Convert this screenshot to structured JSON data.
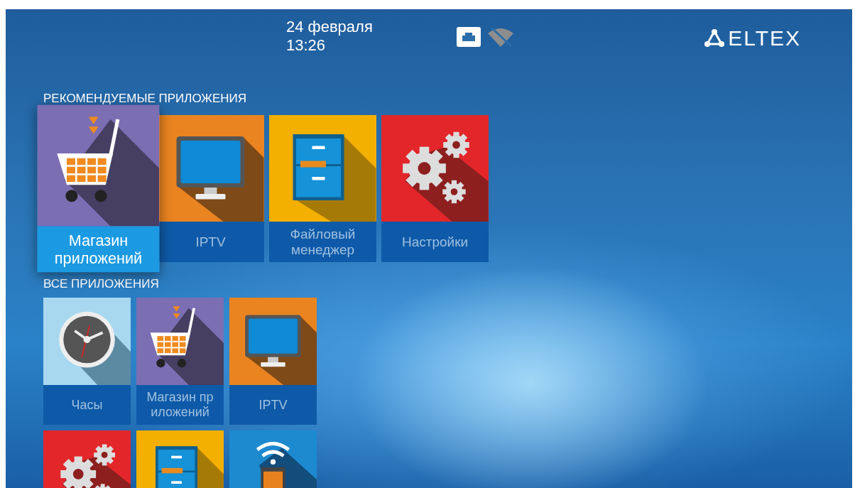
{
  "header": {
    "date": "24 февраля",
    "time": "13:26",
    "network": [
      {
        "kind": "ethernet",
        "on": true
      },
      {
        "kind": "wifi",
        "on": false
      }
    ],
    "logo": "ELTEX"
  },
  "recommended": {
    "title": "РЕКОМЕНДУЕМЫЕ ПРИЛОЖЕНИЯ",
    "apps": [
      {
        "kind": "cart",
        "label": "Магазин приложений",
        "selected": true
      },
      {
        "kind": "monitor",
        "label": "IPTV",
        "selected": false
      },
      {
        "kind": "cabinet",
        "label": "Файловый менеджер",
        "selected": false
      },
      {
        "kind": "gears",
        "label": "Настройки",
        "selected": false
      }
    ]
  },
  "all_apps": {
    "title": "ВСЕ ПРИЛОЖЕНИЯ",
    "apps": [
      {
        "kind": "clock",
        "label": "Часы",
        "selected": false
      },
      {
        "kind": "cart",
        "label": "Магазин пр иложений",
        "selected": false
      },
      {
        "kind": "monitor",
        "label": "IPTV",
        "selected": false
      },
      {
        "kind": "gears",
        "selected": false
      },
      {
        "kind": "cabinet",
        "selected": false
      },
      {
        "kind": "wifi-phone",
        "selected": false
      }
    ]
  }
}
